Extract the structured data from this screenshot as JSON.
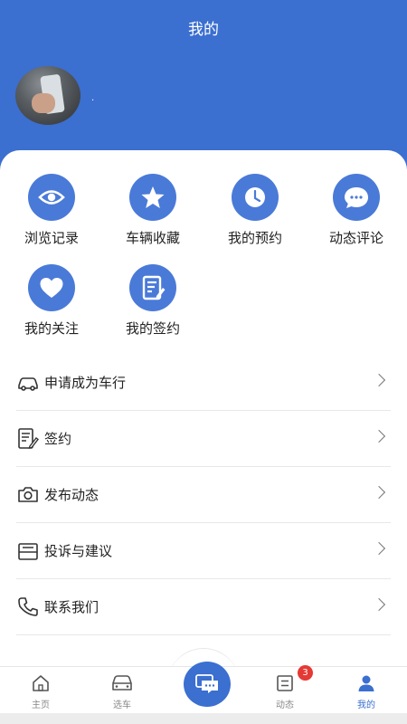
{
  "header": {
    "title": "我的",
    "username": "."
  },
  "grid": [
    {
      "label": "浏览记录",
      "icon": "eye-icon"
    },
    {
      "label": "车辆收藏",
      "icon": "star-icon"
    },
    {
      "label": "我的预约",
      "icon": "clock-icon"
    },
    {
      "label": "动态评论",
      "icon": "chat-bubble-icon"
    },
    {
      "label": "我的关注",
      "icon": "heart-icon"
    },
    {
      "label": "我的签约",
      "icon": "contract-edit-icon"
    }
  ],
  "menu": [
    {
      "label": "申请成为车行",
      "icon": "car-icon"
    },
    {
      "label": "签约",
      "icon": "sign-document-icon"
    },
    {
      "label": "发布动态",
      "icon": "camera-icon"
    },
    {
      "label": "投诉与建议",
      "icon": "inbox-icon"
    },
    {
      "label": "联系我们",
      "icon": "phone-icon"
    }
  ],
  "tabbar": {
    "items": [
      {
        "label": "主页",
        "icon": "home-icon"
      },
      {
        "label": "选车",
        "icon": "car-front-icon"
      },
      {
        "label": "动态",
        "icon": "news-icon"
      },
      {
        "label": "我的",
        "icon": "user-icon"
      }
    ],
    "center_icon": "message-icon",
    "badge_count": "3",
    "active": "我的"
  },
  "colors": {
    "primary": "#3b6fd0",
    "icon_circle": "#4a7ad8",
    "badge": "#e53935"
  }
}
